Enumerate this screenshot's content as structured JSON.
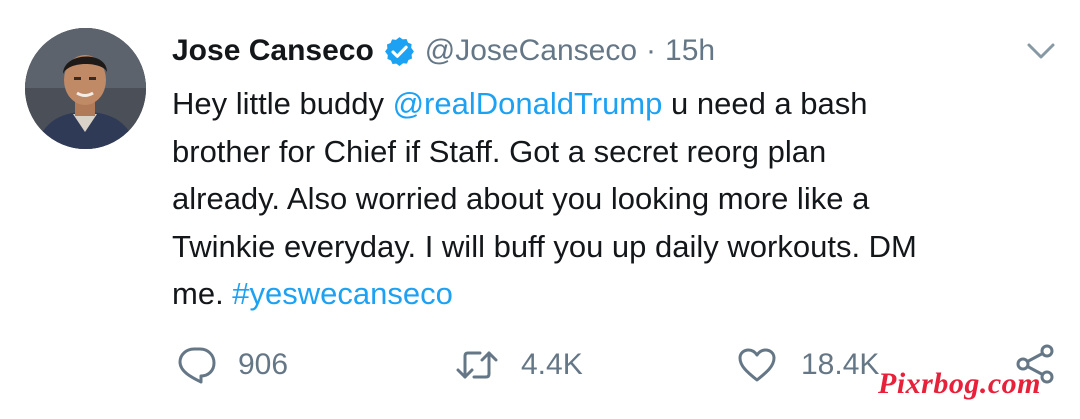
{
  "tweet": {
    "author": {
      "name": "Jose Canseco",
      "handle": "@JoseCanseco",
      "separator": "·",
      "time": "15h",
      "verified_icon": "verified-badge-icon",
      "avatar": "profile-photo"
    },
    "text_segments": [
      {
        "text": "Hey little buddy ",
        "type": "text"
      },
      {
        "text": "@realDonaldTrump",
        "type": "mention"
      },
      {
        "text": " u need a bash\nbrother for Chief if Staff. Got a secret reorg plan\nalready. Also worried about you looking more like a\nTwinkie everyday. I will buff you up daily workouts. DM\nme. ",
        "type": "text"
      },
      {
        "text": "#yeswecanseco",
        "type": "hashtag"
      }
    ],
    "actions": {
      "reply": {
        "icon": "reply-icon",
        "count": "906"
      },
      "retweet": {
        "icon": "retweet-icon",
        "count": "4.4K"
      },
      "like": {
        "icon": "heart-icon",
        "count": "18.4K"
      },
      "share": {
        "icon": "share-icon"
      }
    },
    "menu_icon": "chevron-down-icon"
  },
  "watermark": "Pixrbog.com",
  "colors": {
    "link": "#1da1f2",
    "secondary_text": "#657786",
    "primary_text": "#14171a",
    "watermark": "#e8213b"
  }
}
